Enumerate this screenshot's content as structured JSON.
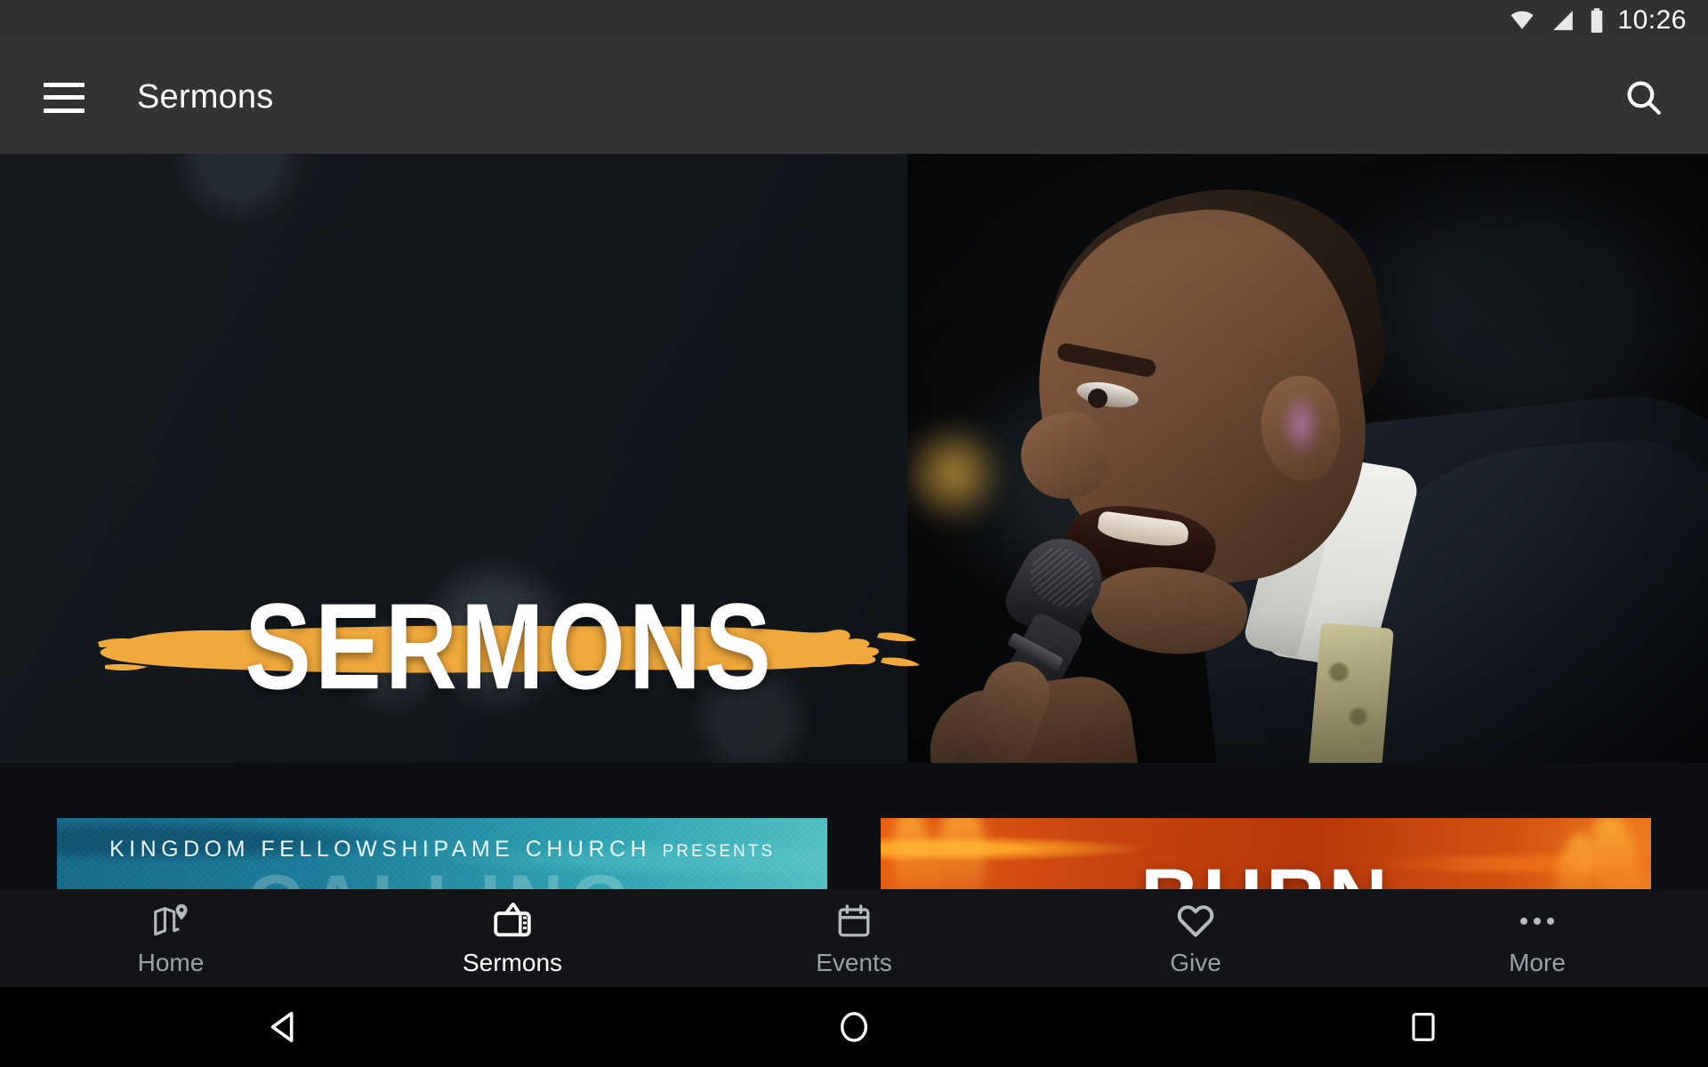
{
  "status_bar": {
    "time": "10:26",
    "icons": [
      "wifi-icon",
      "cellular-signal-icon",
      "battery-icon"
    ]
  },
  "app_bar": {
    "menu_icon": "hamburger-menu-icon",
    "title": "Sermons",
    "search_icon": "search-icon"
  },
  "hero": {
    "title": "SERMONS",
    "brush_color": "#F0A93C",
    "title_color": "#FFFFFF",
    "background_color": "#11161B",
    "image_subject": "preacher holding microphone"
  },
  "cards": [
    {
      "id": "card-calling",
      "presents_line_main": "KINGDOM FELLOWSHIPAME CHURCH",
      "presents_line_small": "PRESENTS",
      "series_title": "CALLING",
      "accent_color": "#2FA6B4"
    },
    {
      "id": "card-burn",
      "series_title": "BURN",
      "accent_color": "#D4520F"
    }
  ],
  "bottom_nav": {
    "active": "Sermons",
    "items": [
      {
        "label": "Home",
        "icon": "map-pin-icon",
        "active": false
      },
      {
        "label": "Sermons",
        "icon": "tv-icon",
        "active": true
      },
      {
        "label": "Events",
        "icon": "calendar-icon",
        "active": false
      },
      {
        "label": "Give",
        "icon": "heart-icon",
        "active": false
      },
      {
        "label": "More",
        "icon": "ellipsis-icon",
        "active": false
      }
    ]
  },
  "system_nav": {
    "back": "back-triangle-icon",
    "home": "home-circle-icon",
    "recents": "recents-square-icon"
  }
}
